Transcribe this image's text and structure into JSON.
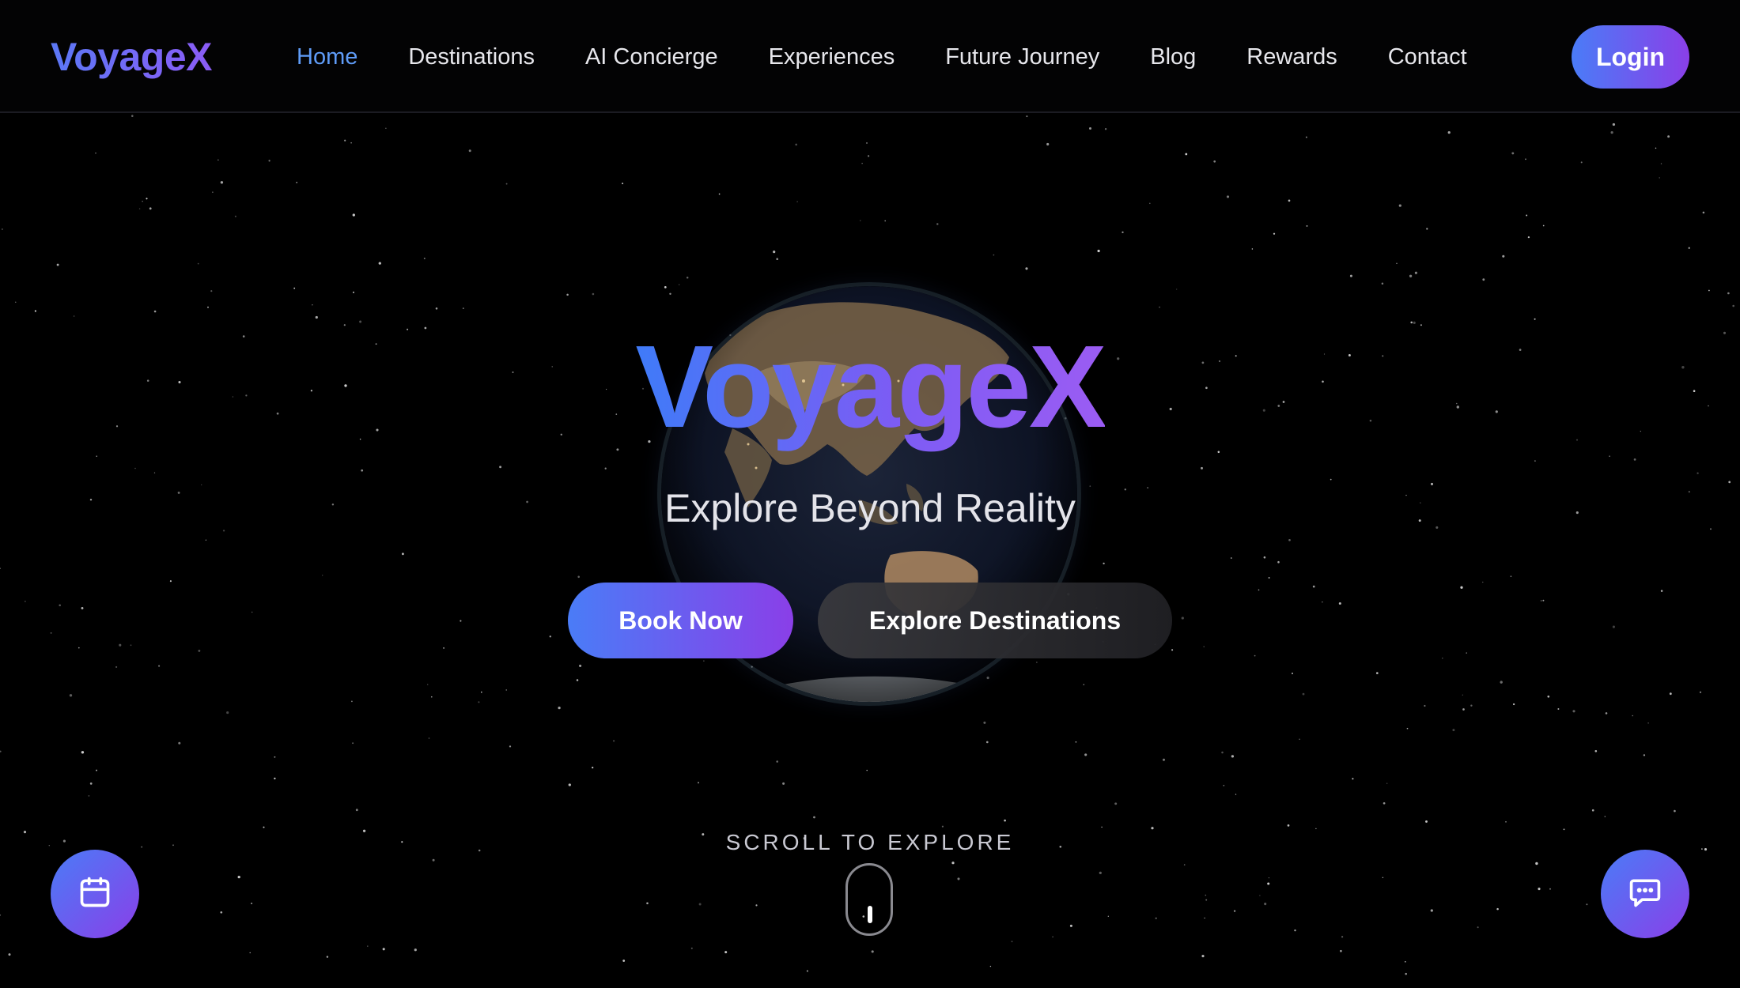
{
  "app": {
    "brand": "VoyageX"
  },
  "nav": {
    "items": [
      {
        "label": "Home",
        "active": true
      },
      {
        "label": "Destinations",
        "active": false
      },
      {
        "label": "AI Concierge",
        "active": false
      },
      {
        "label": "Experiences",
        "active": false
      },
      {
        "label": "Future Journey",
        "active": false
      },
      {
        "label": "Blog",
        "active": false
      },
      {
        "label": "Rewards",
        "active": false
      },
      {
        "label": "Contact",
        "active": false
      }
    ],
    "login_label": "Login"
  },
  "hero": {
    "title": "VoyageX",
    "subtitle": "Explore Beyond Reality",
    "primary_cta": "Book Now",
    "secondary_cta": "Explore Destinations",
    "scroll_hint": "SCROLL TO EXPLORE"
  },
  "floating_actions": {
    "left_icon": "calendar-icon",
    "right_icon": "chat-icon"
  },
  "colors": {
    "background": "#000000",
    "accent_start": "#4a7cf7",
    "accent_end": "#8a3fe8",
    "nav_active": "#5f9cf8"
  }
}
